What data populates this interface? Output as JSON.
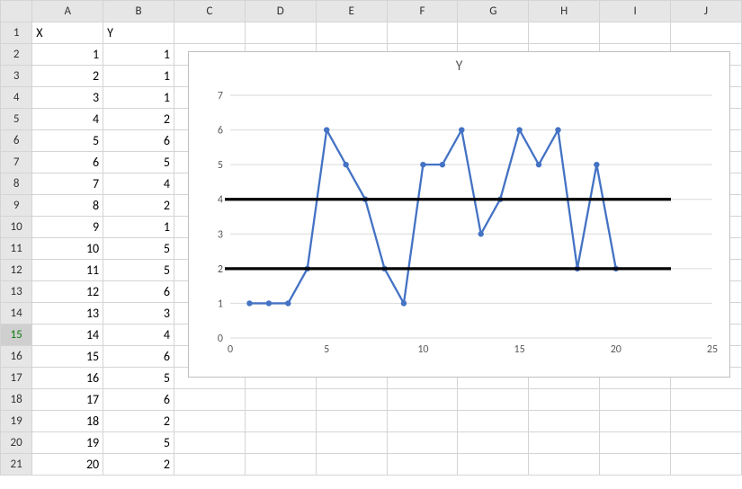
{
  "columns": [
    "A",
    "B",
    "C",
    "D",
    "E",
    "F",
    "G",
    "H",
    "I",
    "J"
  ],
  "row_count": 21,
  "selected_row_header": 15,
  "headers": {
    "A": "X",
    "B": "Y"
  },
  "cells": {
    "A": [
      1,
      2,
      3,
      4,
      5,
      6,
      7,
      8,
      9,
      10,
      11,
      12,
      13,
      14,
      15,
      16,
      17,
      18,
      19,
      20
    ],
    "B": [
      1,
      1,
      1,
      2,
      6,
      5,
      4,
      2,
      1,
      5,
      5,
      6,
      3,
      4,
      6,
      5,
      6,
      2,
      5,
      2
    ]
  },
  "chart_data": {
    "type": "line",
    "title": "Y",
    "x": [
      1,
      2,
      3,
      4,
      5,
      6,
      7,
      8,
      9,
      10,
      11,
      12,
      13,
      14,
      15,
      16,
      17,
      18,
      19,
      20
    ],
    "series": [
      {
        "name": "Y",
        "values": [
          1,
          1,
          1,
          2,
          6,
          5,
          4,
          2,
          1,
          5,
          5,
          6,
          3,
          4,
          6,
          5,
          6,
          2,
          5,
          2
        ],
        "color": "#4472C4"
      }
    ],
    "hlines": [
      4,
      2
    ],
    "xlim": [
      0,
      25
    ],
    "ylim": [
      0,
      7
    ],
    "xticks": [
      0,
      5,
      10,
      15,
      20,
      25
    ],
    "yticks": [
      0,
      1,
      2,
      3,
      4,
      5,
      6,
      7
    ],
    "xlabel": "",
    "ylabel": ""
  }
}
